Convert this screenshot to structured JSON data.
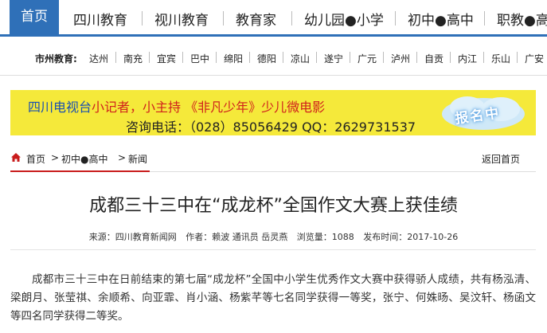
{
  "topnav": {
    "items": [
      "首页",
      "四川教育",
      "视川教育",
      "教育家",
      "幼儿园●小学",
      "初中●高中",
      "职教●高"
    ]
  },
  "citybar": {
    "label": "市州教育:",
    "cities": [
      "达州",
      "南充",
      "宜宾",
      "巴中",
      "绵阳",
      "德阳",
      "凉山",
      "遂宁",
      "广元",
      "泸州",
      "自贡",
      "内江",
      "乐山",
      "广安"
    ]
  },
  "banner": {
    "part1": "四川电视台",
    "part2": "小记者，小主持 《非凡少年》少儿微电影",
    "line2": "咨询电话：（028）85056429  QQ：2629731537",
    "badge": "报名中"
  },
  "breadcrumb": {
    "home": "首页",
    "sep1": ">",
    "cat": "初中●高中",
    "sep2": ">",
    "sub": "新闻",
    "back": "返回首页"
  },
  "article": {
    "title": "成都三十三中在“成龙杯”全国作文大赛上获佳绩",
    "source": "来源：四川教育新闻网",
    "author": "作者：赖波 通讯员 岳灵燕",
    "views": "浏览量：1088",
    "date": "发布时间：2017-10-26",
    "body": "成都市三十三中在日前结束的第七届“成龙杯”全国中小学生优秀作文大赛中获得骄人成绩，共有杨泓清、梁朗月、张莹祺、余顺希、向亚霏、肖小涵、杨紫芊等七名同学获得一等奖，张宁、何姝旸、吴汶轩、杨函文等四名同学获得二等奖。"
  },
  "colors": {
    "nav_blue": "#2f70b8",
    "banner_yellow": "#f5e93a",
    "accent_red": "#c91c1c"
  }
}
